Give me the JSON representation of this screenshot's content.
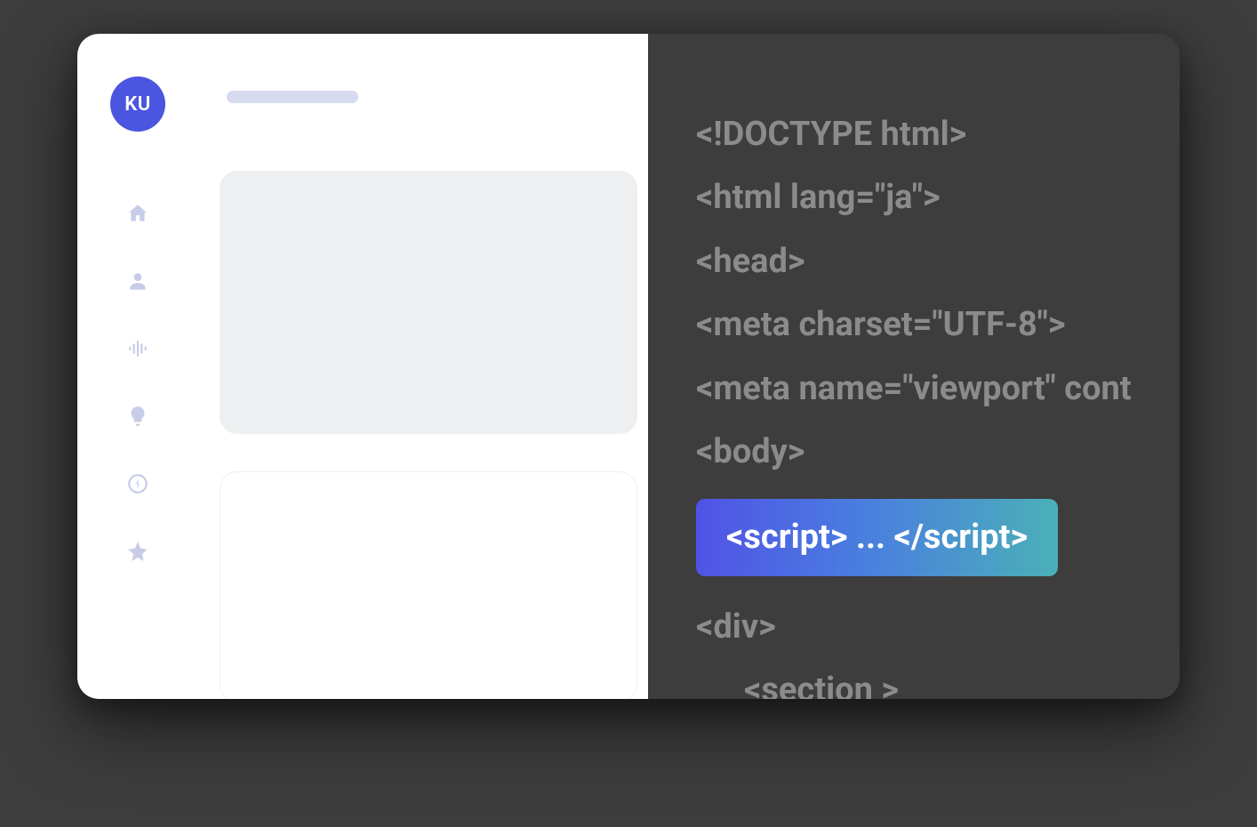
{
  "avatar": {
    "initials": "KU"
  },
  "sidebar": {
    "items": [
      {
        "name": "home-icon"
      },
      {
        "name": "person-icon"
      },
      {
        "name": "sound-icon"
      },
      {
        "name": "lightbulb-icon"
      },
      {
        "name": "bolt-icon"
      },
      {
        "name": "star-icon"
      }
    ]
  },
  "code": {
    "lines": [
      "<!DOCTYPE html>",
      "<html lang=\"ja\">",
      "<head>",
      "<meta charset=\"UTF-8\">",
      "<meta name=\"viewport\" cont",
      "<body>"
    ],
    "highlight": "<script> ... </script>",
    "after": [
      "<div>",
      "<section >"
    ]
  },
  "colors": {
    "accent": "#4a55e0",
    "gradient_start": "#5053e6",
    "gradient_end": "#4bb0b8",
    "icon_muted": "#c7cce8",
    "code_text": "#8b8b8b"
  }
}
